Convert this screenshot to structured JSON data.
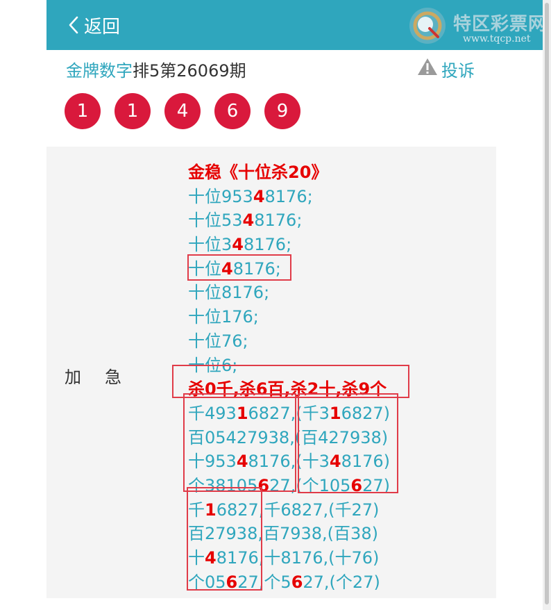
{
  "header": {
    "back_label": "返回",
    "logo_text": "特区彩票网",
    "logo_url": "www.tqcp.net",
    "accent_color": "#2fa6bd"
  },
  "title": {
    "category": "金牌数字",
    "issue": "排5第26069期"
  },
  "complain_label": "投诉",
  "balls": [
    "1",
    "1",
    "4",
    "6",
    "9"
  ],
  "ball_color": "#d9193c",
  "content": {
    "label": "加急",
    "highlight_color": "#e60000",
    "lines": [
      [
        {
          "t": "金稳《十位杀20》",
          "r": true
        }
      ],
      [
        {
          "t": "十位953"
        },
        {
          "t": "4",
          "r": true
        },
        {
          "t": "8176;"
        }
      ],
      [
        {
          "t": "十位53"
        },
        {
          "t": "4",
          "r": true
        },
        {
          "t": "8176;"
        }
      ],
      [
        {
          "t": "十位3"
        },
        {
          "t": "4",
          "r": true
        },
        {
          "t": "8176;"
        }
      ],
      [
        {
          "t": "十位"
        },
        {
          "t": "4",
          "r": true
        },
        {
          "t": "8176;"
        }
      ],
      [
        {
          "t": "十位8176;"
        }
      ],
      [
        {
          "t": "十位176;"
        }
      ],
      [
        {
          "t": "十位76;"
        }
      ],
      [
        {
          "t": "十位6;"
        }
      ],
      [
        {
          "t": "杀0千,杀6百,杀2十,杀9个",
          "r": true
        }
      ],
      [
        {
          "t": "千4931",
          "r": false
        },
        {
          "t": "1",
          "r": true
        },
        {
          "t": "6827,(千3"
        },
        {
          "t": "1",
          "r": true
        },
        {
          "t": "6827)"
        }
      ],
      [
        {
          "t": "百05427938,(百427938)"
        }
      ],
      [
        {
          "t": "十953"
        },
        {
          "t": "4",
          "r": true
        },
        {
          "t": "8176,(十3"
        },
        {
          "t": "4",
          "r": true
        },
        {
          "t": "8176)"
        }
      ],
      [
        {
          "t": "个38105"
        },
        {
          "t": "6",
          "r": true
        },
        {
          "t": "27,(个105"
        },
        {
          "t": "6",
          "r": true
        },
        {
          "t": "27)"
        }
      ],
      [
        {
          "t": "千"
        },
        {
          "t": "1",
          "r": true
        },
        {
          "t": "6827,千6827,(千27)"
        }
      ],
      [
        {
          "t": "百27938,百7938,(百38)"
        }
      ],
      [
        {
          "t": "十"
        },
        {
          "t": "4",
          "r": true
        },
        {
          "t": "8176,十8176,(十76)"
        }
      ],
      [
        {
          "t": "个05"
        },
        {
          "t": "6",
          "r": true
        },
        {
          "t": "27,个5"
        },
        {
          "t": "6",
          "r": true
        },
        {
          "t": "27,(个27)"
        }
      ]
    ]
  }
}
